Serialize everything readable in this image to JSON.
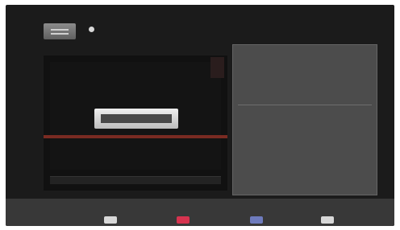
{
  "top_bar": {
    "source_label": "",
    "corner_badge": ""
  },
  "video": {
    "rec_badge": "",
    "caption": "",
    "progress_left": "",
    "progress_right": ""
  },
  "info_panel": {
    "title": "",
    "meta": [
      {
        "left": "",
        "right": ""
      },
      {
        "left": "",
        "right": ""
      }
    ],
    "description": ""
  },
  "button_bar": {
    "buttons": [
      {
        "label": "",
        "color": "#d8d8d8"
      },
      {
        "label": "",
        "color": "#d6334f"
      },
      {
        "label": "",
        "color": "#6e7bbd"
      },
      {
        "label": "",
        "color": "#d8d8d8"
      }
    ]
  },
  "colors": {
    "screen_background": "#1b1b1b",
    "panel_background": "#4c4c4c",
    "accent_red": "#7a2b22",
    "button_bar": "#383838"
  }
}
